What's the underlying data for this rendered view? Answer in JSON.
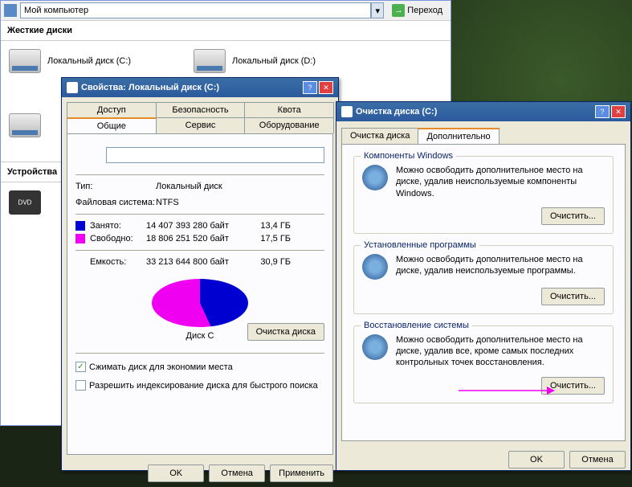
{
  "explorer": {
    "address": "Мой компьютер",
    "go": "Переход",
    "section_hdd": "Жесткие диски",
    "section_devices": "Устройства",
    "drives": {
      "c": "Локальный диск (C:)",
      "d": "Локальный диск (D:)"
    }
  },
  "props": {
    "title": "Свойства: Локальный диск (C:)",
    "tabs": {
      "access": "Доступ",
      "security": "Безопасность",
      "quota": "Квота",
      "general": "Общие",
      "service": "Сервис",
      "hardware": "Оборудование"
    },
    "type_label": "Тип:",
    "type_value": "Локальный диск",
    "fs_label": "Файловая система:",
    "fs_value": "NTFS",
    "used_label": "Занято:",
    "used_bytes": "14 407 393 280 байт",
    "used_gb": "13,4 ГБ",
    "free_label": "Свободно:",
    "free_bytes": "18 806 251 520 байт",
    "free_gb": "17,5 ГБ",
    "capacity_label": "Емкость:",
    "capacity_bytes": "33 213 644 800 байт",
    "capacity_gb": "30,9 ГБ",
    "pie_label": "Диск C",
    "cleanup_btn": "Очистка диска",
    "compress": "Сжимать диск для экономии места",
    "index": "Разрешить индексирование диска для быстрого поиска",
    "ok": "OK",
    "cancel": "Отмена",
    "apply": "Применить"
  },
  "cleanup": {
    "title": "Очистка диска  (C:)",
    "tab1": "Очистка диска",
    "tab2": "Дополнительно",
    "group1_title": "Компоненты Windows",
    "group1_text": "Можно освободить дополнительное место на диске, удалив неиспользуемые компоненты Windows.",
    "group2_title": "Установленные программы",
    "group2_text": "Можно освободить дополнительное место на диске, удалив неиспользуемые программы.",
    "group3_title": "Восстановление системы",
    "group3_text": "Можно освободить дополнительное место на диске, удалив все, кроме самых последних контрольных точек восстановления.",
    "clean_btn": "Очистить...",
    "ok": "OK",
    "cancel": "Отмена"
  },
  "chart_data": {
    "type": "pie",
    "title": "Диск C",
    "series": [
      {
        "name": "Занято",
        "value": 14407393280,
        "display": "13,4 ГБ",
        "color": "#0000d0"
      },
      {
        "name": "Свободно",
        "value": 18806251520,
        "display": "17,5 ГБ",
        "color": "#f000f0"
      }
    ],
    "total": {
      "name": "Емкость",
      "value": 33213644800,
      "display": "30,9 ГБ"
    }
  }
}
